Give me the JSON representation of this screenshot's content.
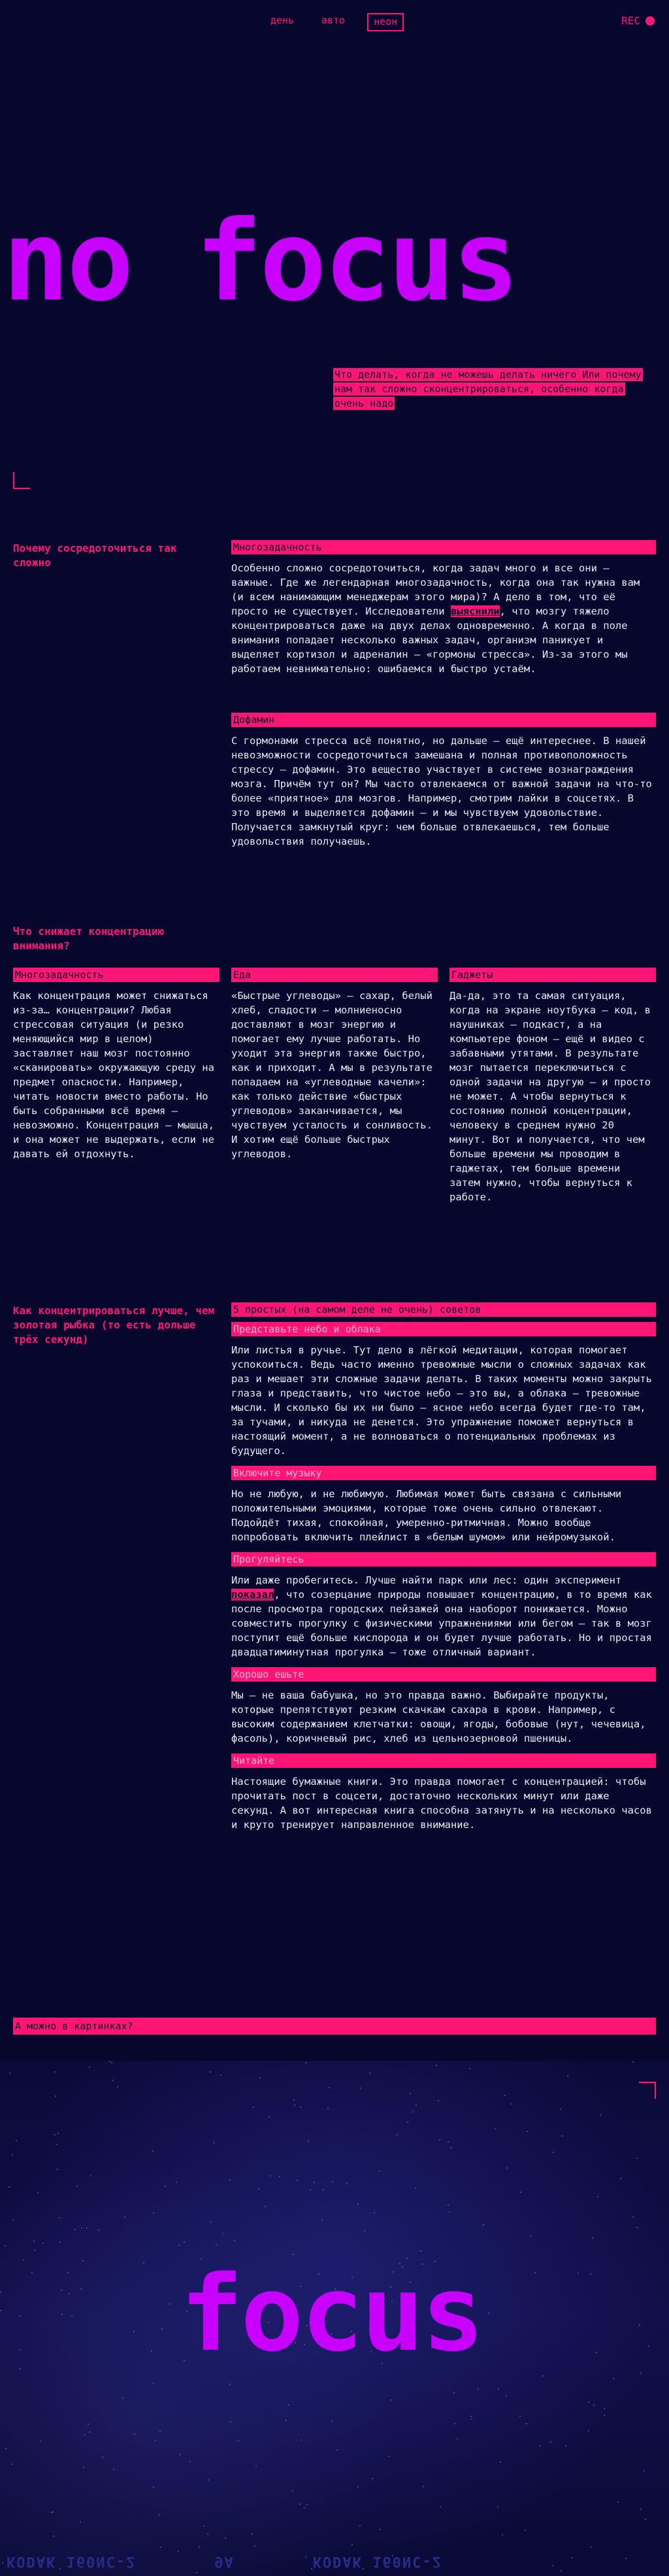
{
  "nav": {
    "items": [
      "день",
      "авто",
      "неон"
    ],
    "active": "неон",
    "rec": "REC"
  },
  "hero": {
    "title": "no focus",
    "subtitle": "Что делать, когда не можешь делать ничего Или почему нам так сложно сконцентрироваться, особенно когда очень надо"
  },
  "section1": {
    "question": "Почему сосредоточиться так сложно",
    "blocks": [
      {
        "heading": "Многозадачность",
        "text_before": "Особенно сложно сосредоточиться, когда задач много и все они — важные. Где же легендарная многозадачность, когда она так нужна вам (и всем нанимающим менеджерам этого мира)? А дело в том, что её просто не существует. Исследователи ",
        "text_mark": "выяснили",
        "text_after": ", что мозгу тяжело концентрироваться даже на двух делах одновременно. А когда в поле внимания попадает несколько важных задач, организм паникует и выделяет кортизол и адреналин — «гормоны стресса». Из-за этого мы работаем невнимательно: ошибаемся и быстро устаём."
      },
      {
        "heading": "Дофамин",
        "text": "С гормонами стресса всё понятно, но дальше — ещё интереснее. В нашей невозможности сосредоточиться замешана и полная противоположность стрессу — дофамин. Это вещество участвует в системе вознаграждения мозга. Причём тут он? Мы часто отвлекаемся от важной задачи на что-то более «приятное» для мозгов. Например, смотрим лайки в соцсетях. В это время и выделяется дофамин — и мы чувствуем удовольствие. Получается замкнутый круг: чем больше отвлекаешься, тем больше удовольствия получаешь."
      }
    ]
  },
  "section2": {
    "question": "Что снижает концентрацию внимания?",
    "columns": [
      {
        "heading": "Многозадачность",
        "text": "Как концентрация может снижаться из-за… концентрации? Любая стрессовая ситуация (и резко меняющийся мир в целом) заставляет наш мозг постоянно «сканировать» окружающую среду на предмет опасности. Например, читать новости вместо работы. Но быть собранными всё время — невозможно. Концентрация — мышца, и она может не выдержать, если не давать ей отдохнуть."
      },
      {
        "heading": "Еда",
        "text": "«Быстрые углеводы» — сахар, белый хлеб, сладости — молниеносно доставляют в мозг энергию и помогает ему лучше работать. Но уходит эта энергия также быстро, как и приходит. А мы в результате попадаем на «углеводные качели»: как только действие «быстрых углеводов» заканчивается, мы чувствуем усталость и сонливость. И хотим ещё больше быстрых углеводов."
      },
      {
        "heading": "Гаджеты",
        "text": "Да-да, это та самая ситуация, когда на экране ноутбука — код, в наушниках — подкаст, а на компьютере фоном — ещё и видео с забавными утятами. В результате мозг пытается переключиться с одной задачи на другую — и просто не может. А чтобы вернуться к состоянию полной концентрации, человеку в среднем нужно 20 минут. Вот и получается, что чем больше времени мы проводим в гаджетах, тем больше времени затем нужно, чтобы вернуться к работе."
      }
    ]
  },
  "section3": {
    "question": "Как концентрироваться лучше, чем золотая рыбка (то есть дольше трёх секунд)",
    "title": "5 простых (на самом деле не очень) советов",
    "tips": [
      {
        "heading": "Представьте небо и облака",
        "text": "Или листья в ручье. Тут дело в лёгкой медитации, которая помогает успокоиться. Ведь часто именно тревожные мысли о сложных задачах как раз и мешает эти сложные задачи делать. В таких моменты можно закрыть глаза и представить, что чистое небо — это вы, а облака — тревожные мысли. И сколько бы их ни было — ясное небо всегда будет где-то там, за тучами, и никуда не денется. Это упражнение поможет вернуться в настоящий момент, а не волноваться о потенциальных проблемах из будущего."
      },
      {
        "heading": "Включите музыку",
        "text": "Но не любую, и не любимую. Любимая может быть связана с сильными положительными эмоциями, которые тоже очень сильно отвлекают. Подойдёт тихая, спокойная, умеренно-ритмичная. Можно вообще попробовать включить плейлист в «белым шумом» или нейромузыкой."
      },
      {
        "heading": "Прогуляйтесь",
        "text_before": "Или даже пробегитесь. Лучше найти парк или лес: один эксперимент ",
        "text_mark": "показал",
        "text_after": ", что созерцание природы повышает концентрацию, в то время как после просмотра городских пейзажей она наоборот понижается. Можно совместить прогулку с физическими упражнениями или бегом — так в мозг поступит ещё больше кислорода и он будет лучше работать. Но и простая двадцатиминутная прогулка — тоже отличный вариант."
      },
      {
        "heading": "Хорошо ешьте",
        "text": "Мы — не ваша бабушка, но это правда важно. Выбирайте продукты, которые препятствуют резким скачкам сахара в крови. Например, с высоким содержанием клетчатки: овощи, ягоды, бобовые (нут, чечевица, фасоль), коричневый рис, хлеб из цельнозерновой пшеницы."
      },
      {
        "heading": "Читайте",
        "text": "Настоящие бумажные книги. Это правда помогает с концентрацией: чтобы прочитать пост в соцсети, достаточно нескольких минут или даже секунд. А вот интересная книга способна затянуть и на несколько часов и круто тренирует направленное внимание."
      }
    ]
  },
  "section4": {
    "question": "А можно в картинках?"
  },
  "photo": {
    "title": "focus",
    "film_marks": [
      "KODAK 160NC-2",
      "9A",
      "KODAK 160NC-2"
    ]
  },
  "colors": {
    "background": "#07072e",
    "accent": "#ff1675",
    "title": "#c700ff"
  }
}
